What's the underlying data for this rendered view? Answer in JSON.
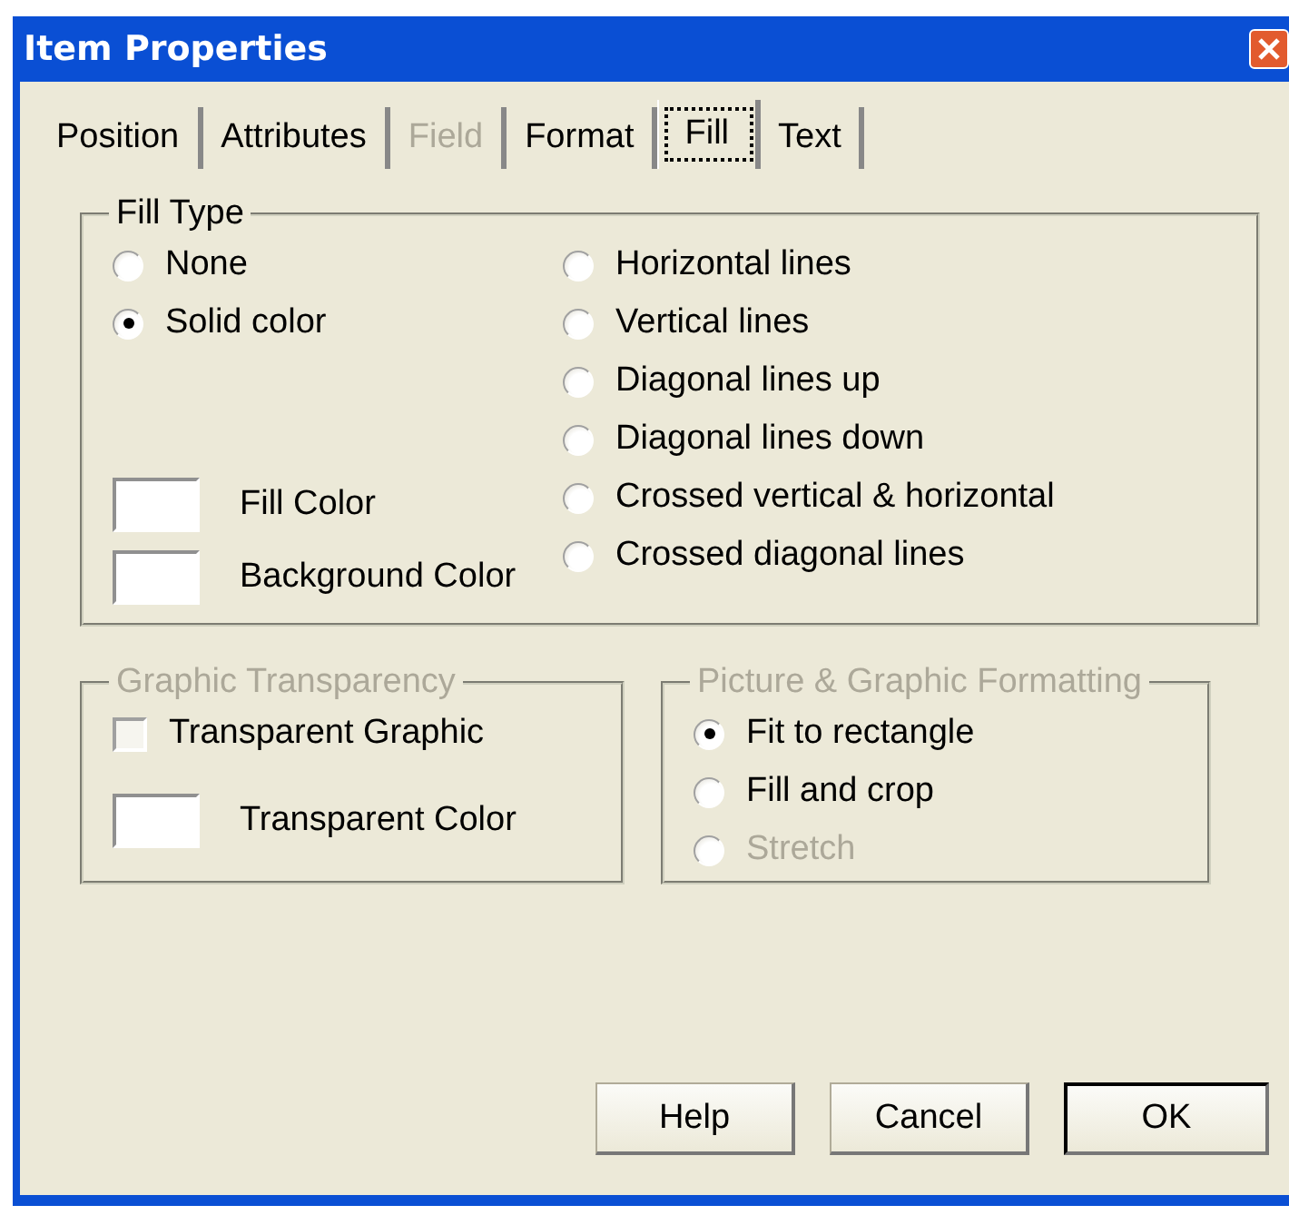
{
  "window": {
    "title": "Item Properties"
  },
  "tabs": [
    {
      "label": "Position",
      "selected": false,
      "disabled": false
    },
    {
      "label": "Attributes",
      "selected": false,
      "disabled": false
    },
    {
      "label": "Field",
      "selected": false,
      "disabled": true
    },
    {
      "label": "Format",
      "selected": false,
      "disabled": false
    },
    {
      "label": "Fill",
      "selected": true,
      "disabled": false
    },
    {
      "label": "Text",
      "selected": false,
      "disabled": false
    }
  ],
  "fill_type": {
    "title": "Fill Type",
    "left_options": [
      {
        "label": "None",
        "selected": false
      },
      {
        "label": "Solid color",
        "selected": true
      }
    ],
    "swatches": [
      {
        "label": "Fill Color"
      },
      {
        "label": "Background Color"
      }
    ],
    "right_options": [
      {
        "label": "Horizontal lines",
        "selected": false
      },
      {
        "label": "Vertical lines",
        "selected": false
      },
      {
        "label": "Diagonal lines up",
        "selected": false
      },
      {
        "label": "Diagonal lines down",
        "selected": false
      },
      {
        "label": "Crossed vertical & horizontal",
        "selected": false
      },
      {
        "label": "Crossed diagonal lines",
        "selected": false
      }
    ]
  },
  "transparency": {
    "title": "Graphic Transparency",
    "disabled": true,
    "checkbox": {
      "label": "Transparent Graphic",
      "checked": false
    },
    "swatch": {
      "label": "Transparent Color"
    }
  },
  "formatting": {
    "title": "Picture & Graphic Formatting",
    "disabled": true,
    "options": [
      {
        "label": "Fit to rectangle",
        "selected": true,
        "disabled": false
      },
      {
        "label": "Fill and crop",
        "selected": false,
        "disabled": false
      },
      {
        "label": "Stretch",
        "selected": false,
        "disabled": true
      }
    ]
  },
  "buttons": [
    {
      "label": "Help",
      "default": false
    },
    {
      "label": "Cancel",
      "default": false
    },
    {
      "label": "OK",
      "default": true
    }
  ]
}
